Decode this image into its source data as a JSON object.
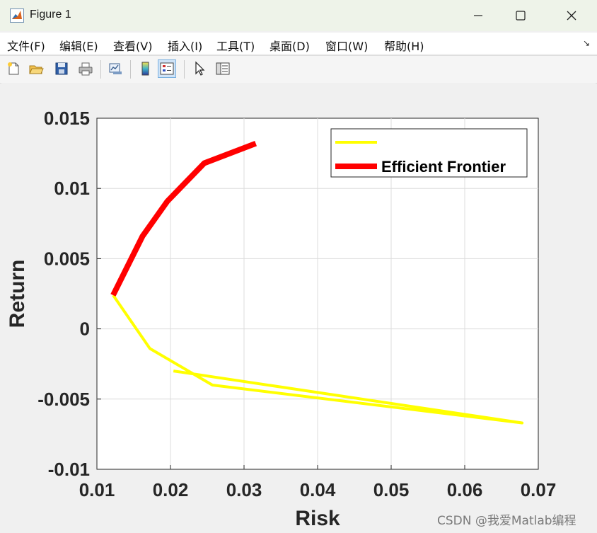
{
  "window": {
    "title": "Figure 1",
    "controls": {
      "minimize": "—",
      "maximize": "☐",
      "close": "✕"
    }
  },
  "menu": {
    "items": [
      "文件(F)",
      "编辑(E)",
      "查看(V)",
      "插入(I)",
      "工具(T)",
      "桌面(D)",
      "窗口(W)",
      "帮助(H)"
    ],
    "overflow_arrow": "↘"
  },
  "toolbar": {
    "icons": [
      "new-figure-icon",
      "open-file-icon",
      "save-icon",
      "print-icon",
      "link-plot-icon",
      "insert-colorbar-icon",
      "insert-legend-icon",
      "edit-plot-icon",
      "property-inspector-icon"
    ]
  },
  "chart_data": {
    "type": "line",
    "xlabel": "Risk",
    "ylabel": "Return",
    "xlim": [
      0.01,
      0.07
    ],
    "ylim": [
      -0.01,
      0.015
    ],
    "xticks": [
      "0.01",
      "0.02",
      "0.03",
      "0.04",
      "0.05",
      "0.06",
      "0.07"
    ],
    "yticks": [
      "0.015",
      "0.01",
      "0.005",
      "0",
      "-0.005",
      "-0.01"
    ],
    "grid": true,
    "legend_position": "top-right",
    "series": [
      {
        "name": "",
        "color": "#ffff00",
        "x": [
          0.0122,
          0.0172,
          0.0257,
          0.0678,
          0.0204
        ],
        "y": [
          0.0024,
          -0.0014,
          -0.004,
          -0.0067,
          -0.003
        ]
      },
      {
        "name": "Efficient Frontier",
        "color": "#ff0000",
        "x": [
          0.0122,
          0.0162,
          0.0196,
          0.0246,
          0.0316
        ],
        "y": [
          0.0024,
          0.0066,
          0.0091,
          0.0118,
          0.0132
        ]
      }
    ]
  },
  "watermark": "CSDN @我爱Matlab编程"
}
